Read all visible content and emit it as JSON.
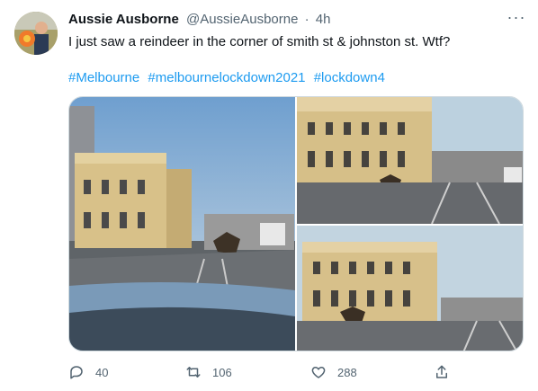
{
  "tweet": {
    "author_name": "Aussie Ausborne",
    "handle": "@AussieAusborne",
    "separator": "·",
    "time": "4h",
    "more_label": "···",
    "text": "I just saw a reindeer in the corner of smith st & johnston st. Wtf?",
    "hashtags": [
      "#Melbourne",
      "#melbournelockdown2021",
      "#lockdown4"
    ]
  },
  "actions": {
    "reply_count": "40",
    "retweet_count": "106",
    "like_count": "288"
  },
  "icons": {
    "reply": "reply-icon",
    "retweet": "retweet-icon",
    "like": "heart-icon",
    "share": "share-icon"
  },
  "colors": {
    "link": "#1d9bf0",
    "secondary_text": "#536471",
    "border": "#cfd9de"
  }
}
